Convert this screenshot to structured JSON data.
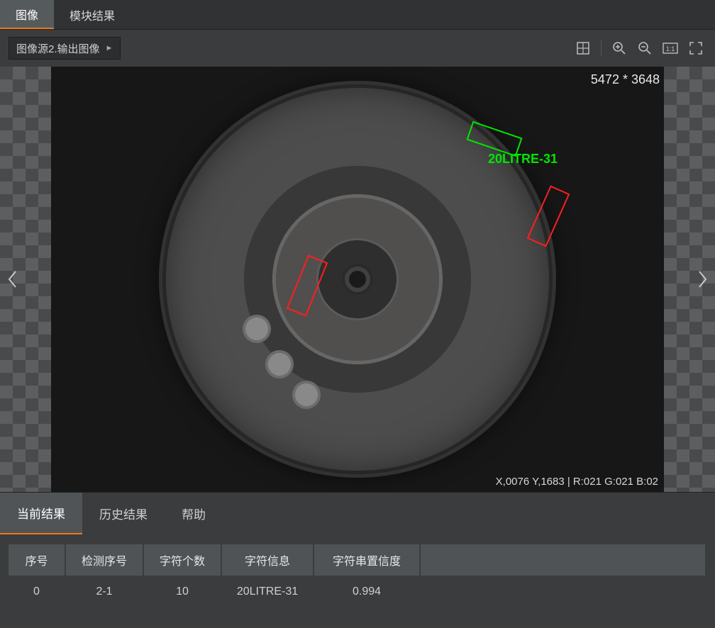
{
  "topTabs": {
    "image": "图像",
    "moduleResult": "模块结果"
  },
  "imageSource": {
    "label": "图像源2.输出图像"
  },
  "viewport": {
    "dimensions": "5472 * 3648",
    "coord": "X,0076  Y,1683  |  R:021  G:021  B:02",
    "detection": {
      "textLabel": "20LITRE-31",
      "textColor": "#00e600",
      "okColor": "#00e600",
      "failColor": "#ff1e1e"
    }
  },
  "resultTabs": {
    "current": "当前结果",
    "history": "历史结果",
    "help": "帮助"
  },
  "table": {
    "headers": {
      "index": "序号",
      "detIndex": "检测序号",
      "charCount": "字符个数",
      "charInfo": "字符信息",
      "confidence": "字符串置信度"
    },
    "rows": [
      {
        "index": "0",
        "detIndex": "2-1",
        "charCount": "10",
        "charInfo": "20LITRE-31",
        "confidence": "0.994"
      }
    ]
  }
}
